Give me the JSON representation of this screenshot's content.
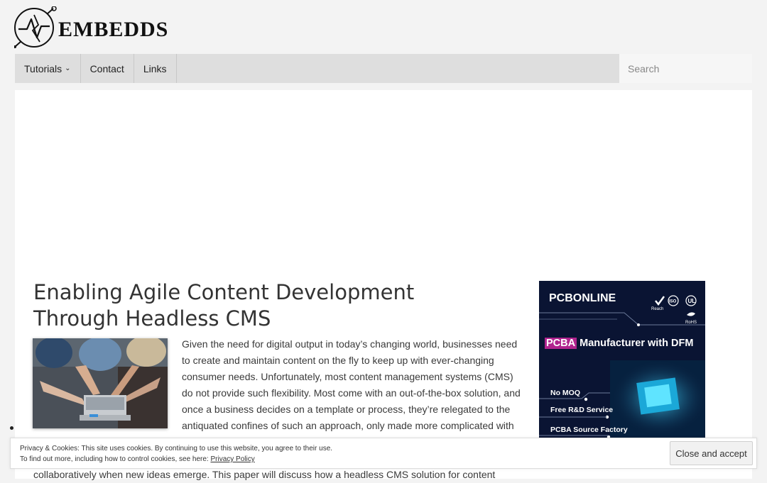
{
  "site": {
    "logo_text": "EMBEDDS"
  },
  "nav": {
    "items": [
      {
        "label": "Tutorials",
        "has_dropdown": true
      },
      {
        "label": "Contact"
      },
      {
        "label": "Links"
      }
    ],
    "search_placeholder": "Search"
  },
  "article": {
    "title": "Enabling Agile Content Development Through Headless CMS",
    "body": "Given the need for digital output in today’s changing world, businesses need to create and maintain content on the fly to keep up with ever-changing consumer needs. Unfortunately, most content management systems (CMS) do not provide such flexibility. Most come with an out-of-the-box solution, and once a business decides on a template or process, they’re relegated to the antiquated confines of such an approach, only made more complicated with",
    "body_continued": "collaboratively when new ideas emerge. This paper will discuss how a headless CMS solution for content"
  },
  "ad": {
    "brand": "PCBONLINE",
    "headline_highlight": "PCBA",
    "headline_rest": " Manufacturer with DFM",
    "features": [
      "No MOQ",
      "Free R&D Service",
      "PCBA Source Factory"
    ],
    "cert_labels": [
      "Reach",
      "ISO",
      "RoHS"
    ]
  },
  "cookie": {
    "line1": "Privacy & Cookies: This site uses cookies. By continuing to use this website, you agree to their use.",
    "line2": "To find out more, including how to control cookies, see here: ",
    "link": "Privacy Policy",
    "button": "Close and accept"
  }
}
